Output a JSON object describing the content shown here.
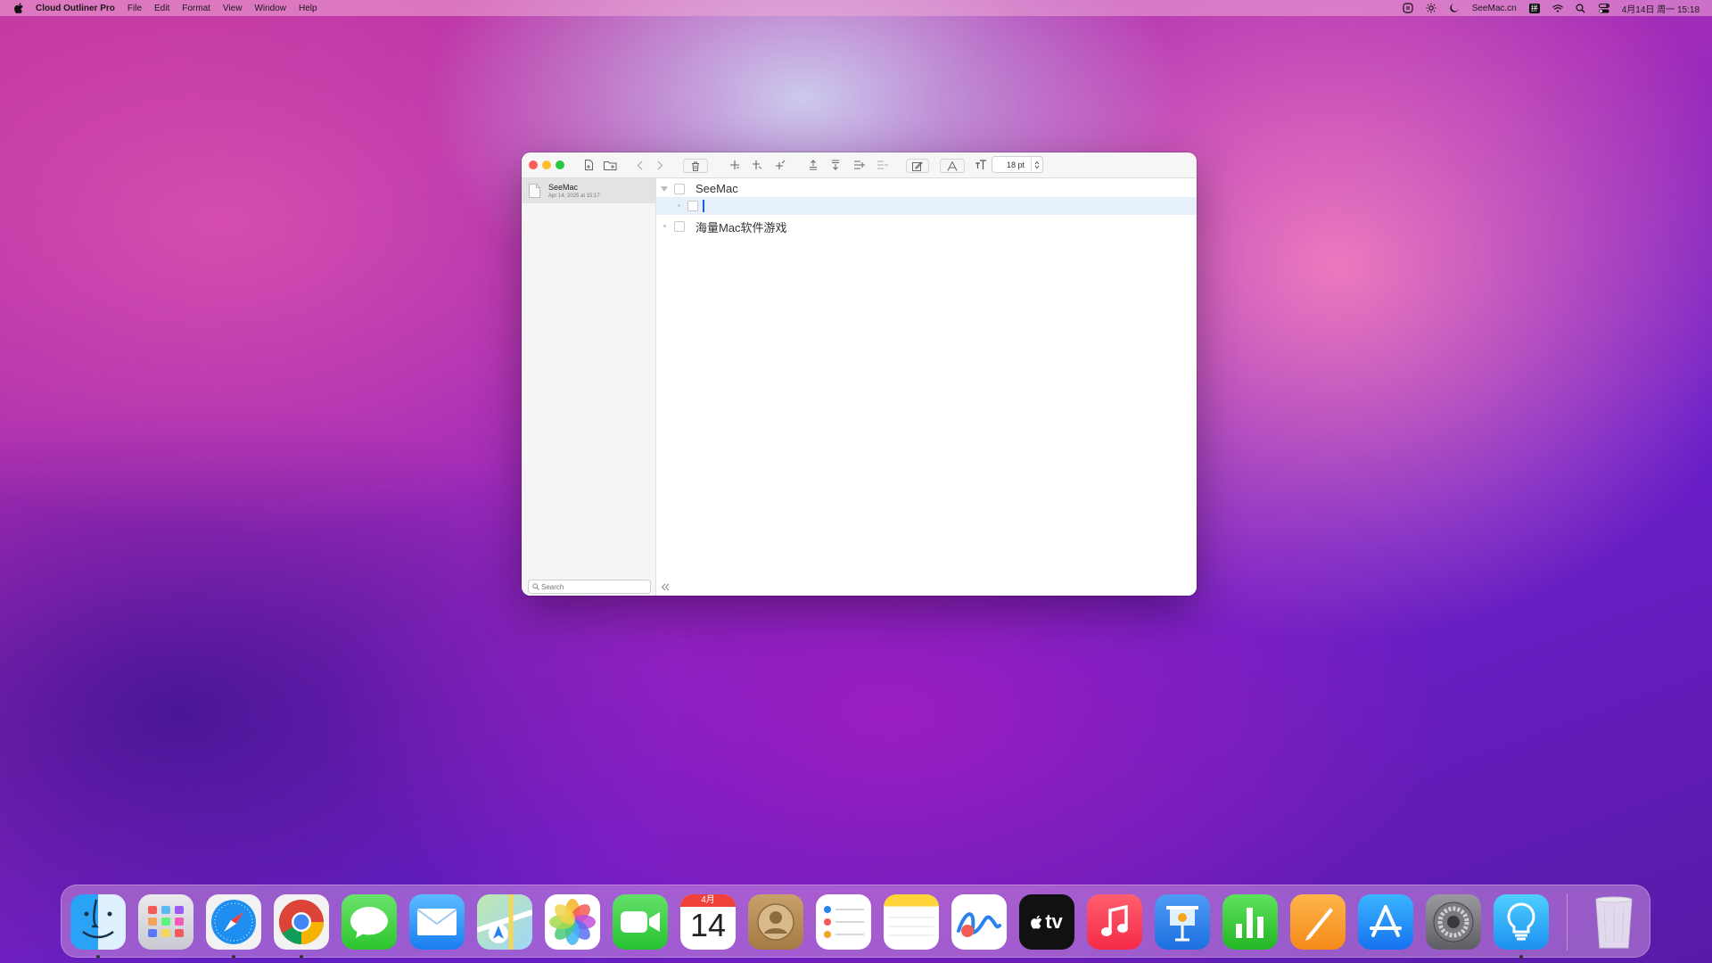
{
  "menubar": {
    "app_name": "Cloud Outliner Pro",
    "menus": [
      "File",
      "Edit",
      "Format",
      "View",
      "Window",
      "Help"
    ],
    "right_text": "SeeMac.cn",
    "input_method": "拼",
    "datetime": "4月14日 周一  15:18"
  },
  "window": {
    "toolbar": {
      "font_size": "18 pt"
    },
    "sidebar": {
      "document": {
        "title": "SeeMac",
        "date": "Apr 14, 2025 at 15:17"
      },
      "search_placeholder": "Search"
    },
    "outline": {
      "rows": [
        {
          "text": "SeeMac",
          "expanded": true,
          "checked": false
        },
        {
          "text": "",
          "editing": true,
          "checked": false
        },
        {
          "text": "海量Mac软件游戏",
          "expanded": false,
          "checked": false
        }
      ]
    }
  },
  "dock": {
    "calendar": {
      "month": "4月",
      "day": "14"
    },
    "tv_label": "tv",
    "apps": [
      "Finder",
      "Launchpad",
      "Safari",
      "Chrome",
      "Messages",
      "Mail",
      "Maps",
      "Photos",
      "FaceTime",
      "Calendar",
      "Contacts",
      "Reminders",
      "Notes",
      "Freeform",
      "TV",
      "Music",
      "Keynote",
      "Numbers",
      "Pages",
      "App Store",
      "System Settings",
      "Cloud Outliner Pro",
      "Trash"
    ]
  }
}
